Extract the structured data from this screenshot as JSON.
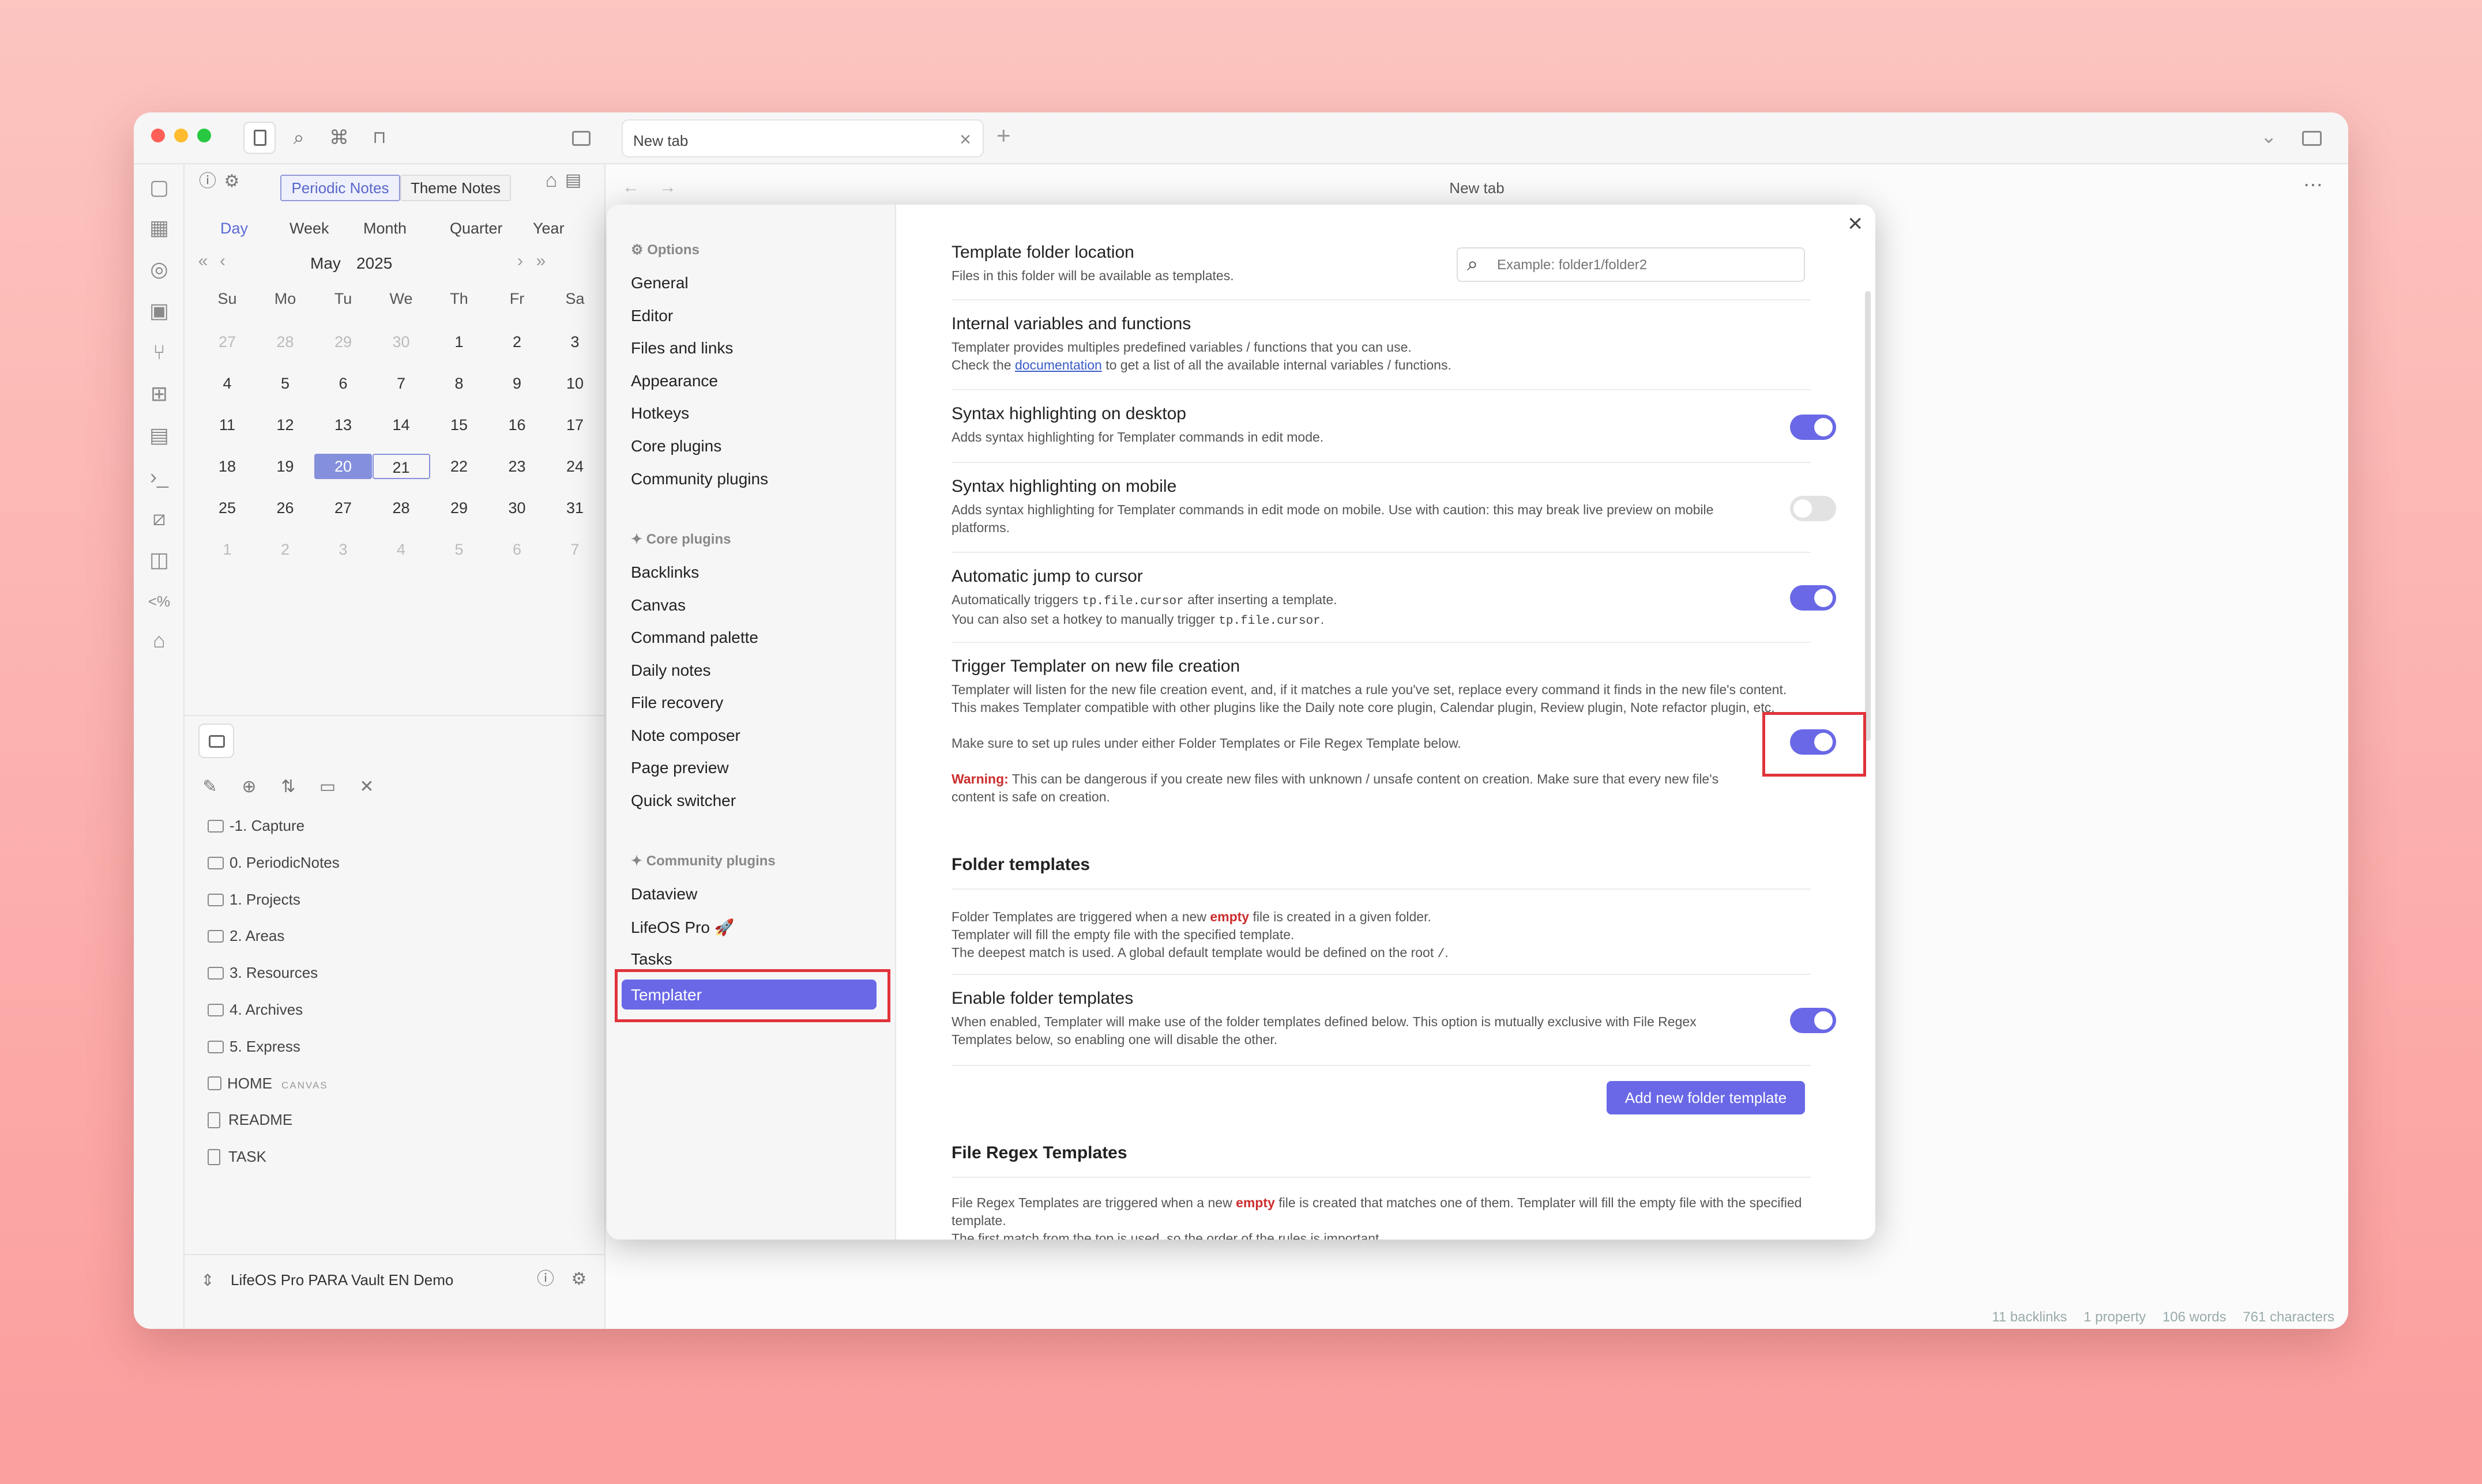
{
  "window": {
    "tab_title": "New tab",
    "new_tab_symbol": "+",
    "tab_close_symbol": "×"
  },
  "left_panel": {
    "switch_tabs": [
      "Periodic Notes",
      "Theme Notes"
    ],
    "period_tabs": [
      "Day",
      "Week",
      "Month",
      "Quarter",
      "Year"
    ],
    "month_label": "May",
    "year_label": "2025",
    "weekdays": [
      "Su",
      "Mo",
      "Tu",
      "We",
      "Th",
      "Fr",
      "Sa"
    ],
    "weeks": [
      [
        "27",
        "28",
        "29",
        "30",
        "1",
        "2",
        "3"
      ],
      [
        "4",
        "5",
        "6",
        "7",
        "8",
        "9",
        "10"
      ],
      [
        "11",
        "12",
        "13",
        "14",
        "15",
        "16",
        "17"
      ],
      [
        "18",
        "19",
        "20",
        "21",
        "22",
        "23",
        "24"
      ],
      [
        "25",
        "26",
        "27",
        "28",
        "29",
        "30",
        "31"
      ],
      [
        "1",
        "2",
        "3",
        "4",
        "5",
        "6",
        "7"
      ]
    ],
    "files": [
      {
        "type": "folder",
        "label": "-1. Capture"
      },
      {
        "type": "folder",
        "label": "0. PeriodicNotes"
      },
      {
        "type": "folder",
        "label": "1. Projects"
      },
      {
        "type": "folder",
        "label": "2. Areas"
      },
      {
        "type": "folder",
        "label": "3. Resources"
      },
      {
        "type": "folder",
        "label": "4. Archives"
      },
      {
        "type": "folder",
        "label": "5. Express"
      },
      {
        "type": "canvas",
        "label": "HOME",
        "badge": "CANVAS"
      },
      {
        "type": "file",
        "label": "README"
      },
      {
        "type": "file",
        "label": "TASK"
      }
    ],
    "vault_name": "LifeOS Pro PARA Vault EN Demo"
  },
  "main": {
    "header_title": "New tab",
    "more_symbol": "⋯"
  },
  "statusbar": [
    "11 backlinks",
    "1 property",
    "106 words",
    "761 characters"
  ],
  "modal": {
    "close_symbol": "×",
    "sidebar": {
      "options_header": "Options",
      "options": [
        "General",
        "Editor",
        "Files and links",
        "Appearance",
        "Hotkeys",
        "Core plugins",
        "Community plugins"
      ],
      "core_header": "Core plugins",
      "core": [
        "Backlinks",
        "Canvas",
        "Command palette",
        "Daily notes",
        "File recovery",
        "Note composer",
        "Page preview",
        "Quick switcher"
      ],
      "community_header": "Community plugins",
      "community": [
        "Dataview",
        "LifeOS Pro 🚀",
        "Tasks",
        "Templater"
      ]
    },
    "settings": {
      "folder_location": {
        "name": "Template folder location",
        "desc": "Files in this folder will be available as templates.",
        "placeholder": "Example: folder1/folder2"
      },
      "internal_vars": {
        "name": "Internal variables and functions",
        "desc1": "Templater provides multiples predefined variables / functions that you can use.",
        "desc2_pre": "Check the ",
        "desc2_link": "documentation",
        "desc2_post": " to get a list of all the available internal variables / functions."
      },
      "syntax_desktop": {
        "name": "Syntax highlighting on desktop",
        "desc": "Adds syntax highlighting for Templater commands in edit mode.",
        "on": true
      },
      "syntax_mobile": {
        "name": "Syntax highlighting on mobile",
        "desc": "Adds syntax highlighting for Templater commands in edit mode on mobile. Use with caution: this may break live preview on mobile platforms.",
        "on": false
      },
      "auto_jump": {
        "name": "Automatic jump to cursor",
        "desc1_pre": "Automatically triggers ",
        "desc1_code": "tp.file.cursor",
        "desc1_post": " after inserting a template.",
        "desc2_pre": "You can also set a hotkey to manually trigger ",
        "desc2_code": "tp.file.cursor",
        "desc2_post": ".",
        "on": true
      },
      "trigger_new": {
        "name": "Trigger Templater on new file creation",
        "desc1": "Templater will listen for the new file creation event, and, if it matches a rule you've set, replace every command it finds in the new file's content. This makes Templater compatible with other plugins like the Daily note core plugin, Calendar plugin, Review plugin, Note refactor plugin, etc.",
        "desc2": "Make sure to set up rules under either Folder Templates or File Regex Template below.",
        "warn_label": "Warning:",
        "warn_text": " This can be dangerous if you create new files with unknown / unsafe content on creation. Make sure that every new file's content is safe on creation.",
        "on": true
      },
      "folder_templates": {
        "heading": "Folder templates",
        "d1_pre": "Folder Templates are triggered when a new ",
        "d1_em": "empty",
        "d1_post": " file is created in a given folder.",
        "d2": "Templater will fill the empty file with the specified template.",
        "d3_pre": "The deepest match is used. A global default template would be defined on the root ",
        "d3_code": "/",
        "d3_post": "."
      },
      "enable_folder": {
        "name": "Enable folder templates",
        "desc": "When enabled, Templater will make use of the folder templates defined below. This option is mutually exclusive with File Regex Templates below, so enabling one will disable the other.",
        "on": true
      },
      "add_button": "Add new folder template",
      "regex_templates": {
        "heading": "File Regex Templates",
        "d1_pre": "File Regex Templates are triggered when a new ",
        "d1_em": "empty",
        "d1_post": " file is created that matches one of them. Templater will fill the empty file with the specified template.",
        "d2": "The first match from the top is used, so the order of the rules is important."
      }
    }
  },
  "colors": {
    "accent": "#6a68e6",
    "highlight": "#e0333a",
    "warning": "#cc2d2d",
    "link": "#3a5bc7"
  }
}
